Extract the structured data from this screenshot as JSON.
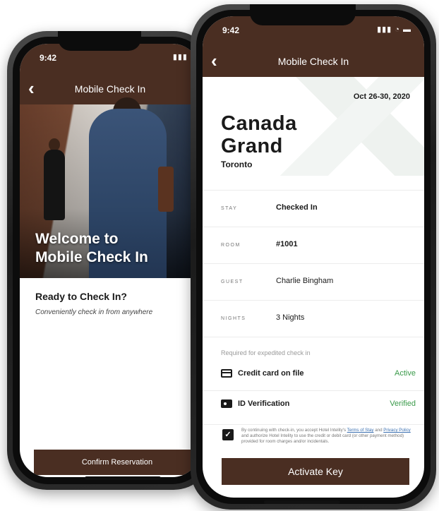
{
  "back_screen": {
    "status_time": "9:42",
    "status_icons": "▮▮▮",
    "nav_title": "Mobile Check In",
    "back_glyph": "‹",
    "hero_title_line1": "Welcome to",
    "hero_title_line2": "Mobile Check In",
    "ready_title": "Ready to Check In?",
    "ready_subtitle": "Conveniently check in from anywhere",
    "confirm_label": "Confirm Reservation"
  },
  "front_screen": {
    "status_time": "9:42",
    "status_icons": "▮▮▮ ◔ ▬",
    "nav_title": "Mobile Check In",
    "back_glyph": "‹",
    "dates": "Oct 26-30, 2020",
    "hotel_line1": "Canada",
    "hotel_line2": "Grand",
    "city": "Toronto",
    "details": [
      {
        "label": "STAY",
        "value": "Checked In"
      },
      {
        "label": "ROOM",
        "value": "#1001"
      },
      {
        "label": "GUEST",
        "value": "Charlie Bingham"
      },
      {
        "label": "NIGHTS",
        "value": "3 Nights"
      }
    ],
    "required_note": "Required for expedited check in",
    "features": [
      {
        "name": "Credit card on file",
        "state": "Active",
        "icon": "credit-card-icon"
      },
      {
        "name": "ID Verification",
        "state": "Verified",
        "icon": "id-card-icon"
      }
    ],
    "consent": {
      "checked_glyph": "✓",
      "text_before": "By continuing with check-in, you accept Hotel Intelity's ",
      "terms_link": "Terms of Stay",
      "text_and": " and ",
      "privacy_link": "Privacy Policy",
      "text_after": " and authorize Hotel Intelity to use the credit or debit card (or other payment method) provided for room charges and/or incidentals."
    },
    "activate_label": "Activate Key"
  },
  "colors": {
    "brand_brown": "#4a2e22",
    "status_green": "#3a9a4a",
    "link_blue": "#3a6fb0"
  }
}
